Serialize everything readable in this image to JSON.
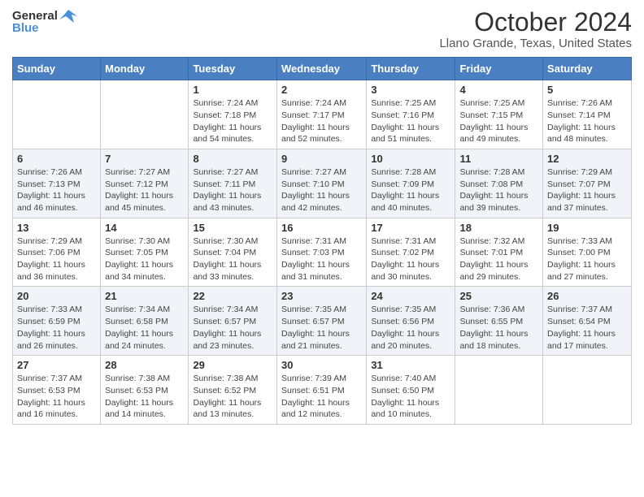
{
  "header": {
    "logo_general": "General",
    "logo_blue": "Blue",
    "title": "October 2024",
    "subtitle": "Llano Grande, Texas, United States"
  },
  "weekdays": [
    "Sunday",
    "Monday",
    "Tuesday",
    "Wednesday",
    "Thursday",
    "Friday",
    "Saturday"
  ],
  "weeks": [
    [
      {
        "day": "",
        "sunrise": "",
        "sunset": "",
        "daylight": ""
      },
      {
        "day": "",
        "sunrise": "",
        "sunset": "",
        "daylight": ""
      },
      {
        "day": "1",
        "sunrise": "Sunrise: 7:24 AM",
        "sunset": "Sunset: 7:18 PM",
        "daylight": "Daylight: 11 hours and 54 minutes."
      },
      {
        "day": "2",
        "sunrise": "Sunrise: 7:24 AM",
        "sunset": "Sunset: 7:17 PM",
        "daylight": "Daylight: 11 hours and 52 minutes."
      },
      {
        "day": "3",
        "sunrise": "Sunrise: 7:25 AM",
        "sunset": "Sunset: 7:16 PM",
        "daylight": "Daylight: 11 hours and 51 minutes."
      },
      {
        "day": "4",
        "sunrise": "Sunrise: 7:25 AM",
        "sunset": "Sunset: 7:15 PM",
        "daylight": "Daylight: 11 hours and 49 minutes."
      },
      {
        "day": "5",
        "sunrise": "Sunrise: 7:26 AM",
        "sunset": "Sunset: 7:14 PM",
        "daylight": "Daylight: 11 hours and 48 minutes."
      }
    ],
    [
      {
        "day": "6",
        "sunrise": "Sunrise: 7:26 AM",
        "sunset": "Sunset: 7:13 PM",
        "daylight": "Daylight: 11 hours and 46 minutes."
      },
      {
        "day": "7",
        "sunrise": "Sunrise: 7:27 AM",
        "sunset": "Sunset: 7:12 PM",
        "daylight": "Daylight: 11 hours and 45 minutes."
      },
      {
        "day": "8",
        "sunrise": "Sunrise: 7:27 AM",
        "sunset": "Sunset: 7:11 PM",
        "daylight": "Daylight: 11 hours and 43 minutes."
      },
      {
        "day": "9",
        "sunrise": "Sunrise: 7:27 AM",
        "sunset": "Sunset: 7:10 PM",
        "daylight": "Daylight: 11 hours and 42 minutes."
      },
      {
        "day": "10",
        "sunrise": "Sunrise: 7:28 AM",
        "sunset": "Sunset: 7:09 PM",
        "daylight": "Daylight: 11 hours and 40 minutes."
      },
      {
        "day": "11",
        "sunrise": "Sunrise: 7:28 AM",
        "sunset": "Sunset: 7:08 PM",
        "daylight": "Daylight: 11 hours and 39 minutes."
      },
      {
        "day": "12",
        "sunrise": "Sunrise: 7:29 AM",
        "sunset": "Sunset: 7:07 PM",
        "daylight": "Daylight: 11 hours and 37 minutes."
      }
    ],
    [
      {
        "day": "13",
        "sunrise": "Sunrise: 7:29 AM",
        "sunset": "Sunset: 7:06 PM",
        "daylight": "Daylight: 11 hours and 36 minutes."
      },
      {
        "day": "14",
        "sunrise": "Sunrise: 7:30 AM",
        "sunset": "Sunset: 7:05 PM",
        "daylight": "Daylight: 11 hours and 34 minutes."
      },
      {
        "day": "15",
        "sunrise": "Sunrise: 7:30 AM",
        "sunset": "Sunset: 7:04 PM",
        "daylight": "Daylight: 11 hours and 33 minutes."
      },
      {
        "day": "16",
        "sunrise": "Sunrise: 7:31 AM",
        "sunset": "Sunset: 7:03 PM",
        "daylight": "Daylight: 11 hours and 31 minutes."
      },
      {
        "day": "17",
        "sunrise": "Sunrise: 7:31 AM",
        "sunset": "Sunset: 7:02 PM",
        "daylight": "Daylight: 11 hours and 30 minutes."
      },
      {
        "day": "18",
        "sunrise": "Sunrise: 7:32 AM",
        "sunset": "Sunset: 7:01 PM",
        "daylight": "Daylight: 11 hours and 29 minutes."
      },
      {
        "day": "19",
        "sunrise": "Sunrise: 7:33 AM",
        "sunset": "Sunset: 7:00 PM",
        "daylight": "Daylight: 11 hours and 27 minutes."
      }
    ],
    [
      {
        "day": "20",
        "sunrise": "Sunrise: 7:33 AM",
        "sunset": "Sunset: 6:59 PM",
        "daylight": "Daylight: 11 hours and 26 minutes."
      },
      {
        "day": "21",
        "sunrise": "Sunrise: 7:34 AM",
        "sunset": "Sunset: 6:58 PM",
        "daylight": "Daylight: 11 hours and 24 minutes."
      },
      {
        "day": "22",
        "sunrise": "Sunrise: 7:34 AM",
        "sunset": "Sunset: 6:57 PM",
        "daylight": "Daylight: 11 hours and 23 minutes."
      },
      {
        "day": "23",
        "sunrise": "Sunrise: 7:35 AM",
        "sunset": "Sunset: 6:57 PM",
        "daylight": "Daylight: 11 hours and 21 minutes."
      },
      {
        "day": "24",
        "sunrise": "Sunrise: 7:35 AM",
        "sunset": "Sunset: 6:56 PM",
        "daylight": "Daylight: 11 hours and 20 minutes."
      },
      {
        "day": "25",
        "sunrise": "Sunrise: 7:36 AM",
        "sunset": "Sunset: 6:55 PM",
        "daylight": "Daylight: 11 hours and 18 minutes."
      },
      {
        "day": "26",
        "sunrise": "Sunrise: 7:37 AM",
        "sunset": "Sunset: 6:54 PM",
        "daylight": "Daylight: 11 hours and 17 minutes."
      }
    ],
    [
      {
        "day": "27",
        "sunrise": "Sunrise: 7:37 AM",
        "sunset": "Sunset: 6:53 PM",
        "daylight": "Daylight: 11 hours and 16 minutes."
      },
      {
        "day": "28",
        "sunrise": "Sunrise: 7:38 AM",
        "sunset": "Sunset: 6:53 PM",
        "daylight": "Daylight: 11 hours and 14 minutes."
      },
      {
        "day": "29",
        "sunrise": "Sunrise: 7:38 AM",
        "sunset": "Sunset: 6:52 PM",
        "daylight": "Daylight: 11 hours and 13 minutes."
      },
      {
        "day": "30",
        "sunrise": "Sunrise: 7:39 AM",
        "sunset": "Sunset: 6:51 PM",
        "daylight": "Daylight: 11 hours and 12 minutes."
      },
      {
        "day": "31",
        "sunrise": "Sunrise: 7:40 AM",
        "sunset": "Sunset: 6:50 PM",
        "daylight": "Daylight: 11 hours and 10 minutes."
      },
      {
        "day": "",
        "sunrise": "",
        "sunset": "",
        "daylight": ""
      },
      {
        "day": "",
        "sunrise": "",
        "sunset": "",
        "daylight": ""
      }
    ]
  ]
}
